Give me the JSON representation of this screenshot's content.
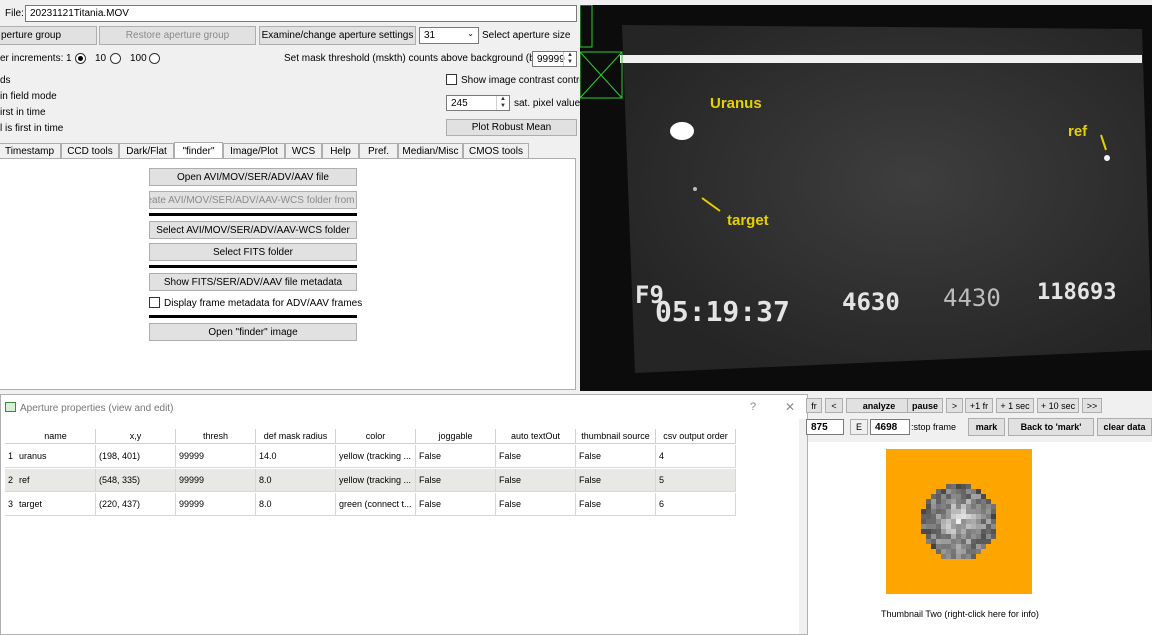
{
  "file": {
    "label": "File:",
    "value": "20231121Titania.MOV"
  },
  "aperture_buttons": {
    "add_group": "perture group",
    "restore_group": "Restore aperture group",
    "examine_settings": "Examine/change aperture settings",
    "size_value": "31",
    "size_label": "Select aperture size"
  },
  "increments": {
    "label": "er increments:",
    "options": [
      "1",
      "10",
      "100"
    ],
    "selected": "10"
  },
  "threshold": {
    "label": "Set mask threshold (mskth) counts above background (bkavg)",
    "value": "99999"
  },
  "left_partial": [
    "ds",
    "in field mode",
    "irst in time",
    "l is first in time"
  ],
  "contrast": {
    "label": "Show image contrast control",
    "checked": false
  },
  "sat_pixel": {
    "value": "245",
    "label": "sat. pixel value"
  },
  "robust_mean": "Plot Robust Mean",
  "tabs": [
    "Timestamp",
    "CCD tools",
    "Dark/Flat",
    "\"finder\"",
    "Image/Plot",
    "WCS",
    "Help",
    "Pref.",
    "Median/Misc",
    "CMOS tools"
  ],
  "finder_panel": {
    "open_file": "Open AVI/MOV/SER/ADV/AAV file",
    "create_folder": "Create AVI/MOV/SER/ADV/AAV-WCS folder from file",
    "select_folder": "Select AVI/MOV/SER/ADV/AAV-WCS folder",
    "select_fits": "Select FITS folder",
    "show_metadata": "Show FITS/SER/ADV/AAV file metadata",
    "display_metadata": "Display frame metadata for ADV/AAV frames",
    "open_finder": "Open \"finder\" image"
  },
  "image": {
    "labels": {
      "uranus": "Uranus",
      "target": "target",
      "ref": "ref"
    },
    "osd": {
      "f": "F9",
      "time": "05:19:37",
      "n1": "4630",
      "n2": "4430",
      "n3": "118693"
    }
  },
  "aperture_dialog": {
    "title": "Aperture properties (view and edit)",
    "help": "?",
    "close": "✕",
    "columns": [
      "name",
      "x,y",
      "thresh",
      "def mask radius",
      "color",
      "joggable",
      "auto textOut",
      "thumbnail source",
      "csv output order"
    ],
    "rows": [
      {
        "num": "1",
        "cells": [
          "uranus",
          "(198, 401)",
          "99999",
          "14.0",
          "yellow (tracking ...",
          "False",
          "False",
          "False",
          "4"
        ]
      },
      {
        "num": "2",
        "cells": [
          "ref",
          "(548, 335)",
          "99999",
          "8.0",
          "yellow (tracking ...",
          "False",
          "False",
          "False",
          "5"
        ]
      },
      {
        "num": "3",
        "cells": [
          "target",
          "(220, 437)",
          "99999",
          "8.0",
          "green (connect t...",
          "False",
          "False",
          "False",
          "6"
        ]
      }
    ]
  },
  "playback": {
    "prev_fr": "fr",
    "back": "<",
    "analyze": "analyze",
    "pause": "pause",
    "fwd": ">",
    "plus_fr": "+1 fr",
    "plus_1s": "+ 1 sec",
    "plus_10s": "+ 10 sec",
    "end": ">>",
    "start_frame": "875",
    "e_label": "E",
    "stop_frame": "4698",
    "stop_label": ":stop frame",
    "mark": "mark",
    "back_mark": "Back to 'mark'",
    "clear": "clear data"
  },
  "thumbnail": {
    "caption": "Thumbnail Two (right-click here for info)",
    "bg_color": "#ffa500"
  }
}
